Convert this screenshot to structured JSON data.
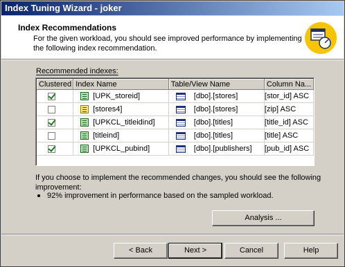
{
  "window": {
    "title": "Index Tuning Wizard - joker"
  },
  "header": {
    "title": "Index Recommendations",
    "description": "For the given workload, you should see improved performance by implementing the following index recommendation."
  },
  "recommended": {
    "label": "Recommended indexes:",
    "columns": [
      "Clustered",
      "Index Name",
      "Table/View Name",
      "Column Na..."
    ],
    "rows": [
      {
        "clustered": true,
        "index_icon": "index-icon",
        "index_name": "[UPK_storeid]",
        "table": "[dbo].[stores]",
        "column": "[stor_id] ASC"
      },
      {
        "clustered": false,
        "index_icon": "new-index-icon",
        "index_name": "[stores4]",
        "table": "[dbo].[stores]",
        "column": "[zip] ASC"
      },
      {
        "clustered": true,
        "index_icon": "index-icon",
        "index_name": "[UPKCL_titleidind]",
        "table": "[dbo].[titles]",
        "column": "[title_id] ASC"
      },
      {
        "clustered": false,
        "index_icon": "index-icon",
        "index_name": "[titleind]",
        "table": "[dbo].[titles]",
        "column": "[title] ASC"
      },
      {
        "clustered": true,
        "index_icon": "index-icon",
        "index_name": "[UPKCL_pubind]",
        "table": "[dbo].[publishers]",
        "column": "[pub_id] ASC"
      }
    ]
  },
  "improvement": {
    "text": "If you choose to implement the recommended changes, you should see the following improvement:",
    "bullet": "92% improvement in performance based on the sampled workload."
  },
  "buttons": {
    "analysis": "Analysis ...",
    "back": "< Back",
    "next": "Next >",
    "cancel": "Cancel",
    "help": "Help"
  }
}
